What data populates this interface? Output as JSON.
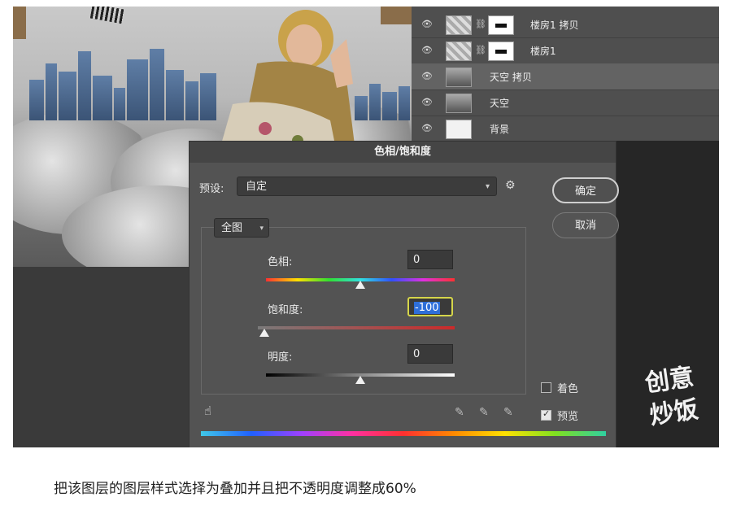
{
  "layers_panel": {
    "layers": [
      {
        "name": "楼房1 拷贝",
        "thumb": "checker",
        "has_mask": true,
        "selected": false
      },
      {
        "name": "楼房1",
        "thumb": "checker",
        "has_mask": true,
        "selected": false
      },
      {
        "name": "天空 拷贝",
        "thumb": "sky",
        "has_mask": false,
        "selected": true
      },
      {
        "name": "天空",
        "thumb": "sky",
        "has_mask": false,
        "selected": false
      },
      {
        "name": "背景",
        "thumb": "white",
        "has_mask": false,
        "selected": false
      }
    ]
  },
  "dialog": {
    "title": "色相/饱和度",
    "preset_label": "预设:",
    "preset_value": "自定",
    "ok_label": "确定",
    "cancel_label": "取消",
    "channel_value": "全图",
    "hue_label": "色相:",
    "hue_value": "0",
    "saturation_label": "饱和度:",
    "saturation_value": "-100",
    "lightness_label": "明度:",
    "lightness_value": "0",
    "colorize_label": "着色",
    "colorize_checked": false,
    "preview_label": "预览",
    "preview_checked": true
  },
  "caption": "把该图层的图层样式选择为叠加并且把不透明度调整成60%"
}
